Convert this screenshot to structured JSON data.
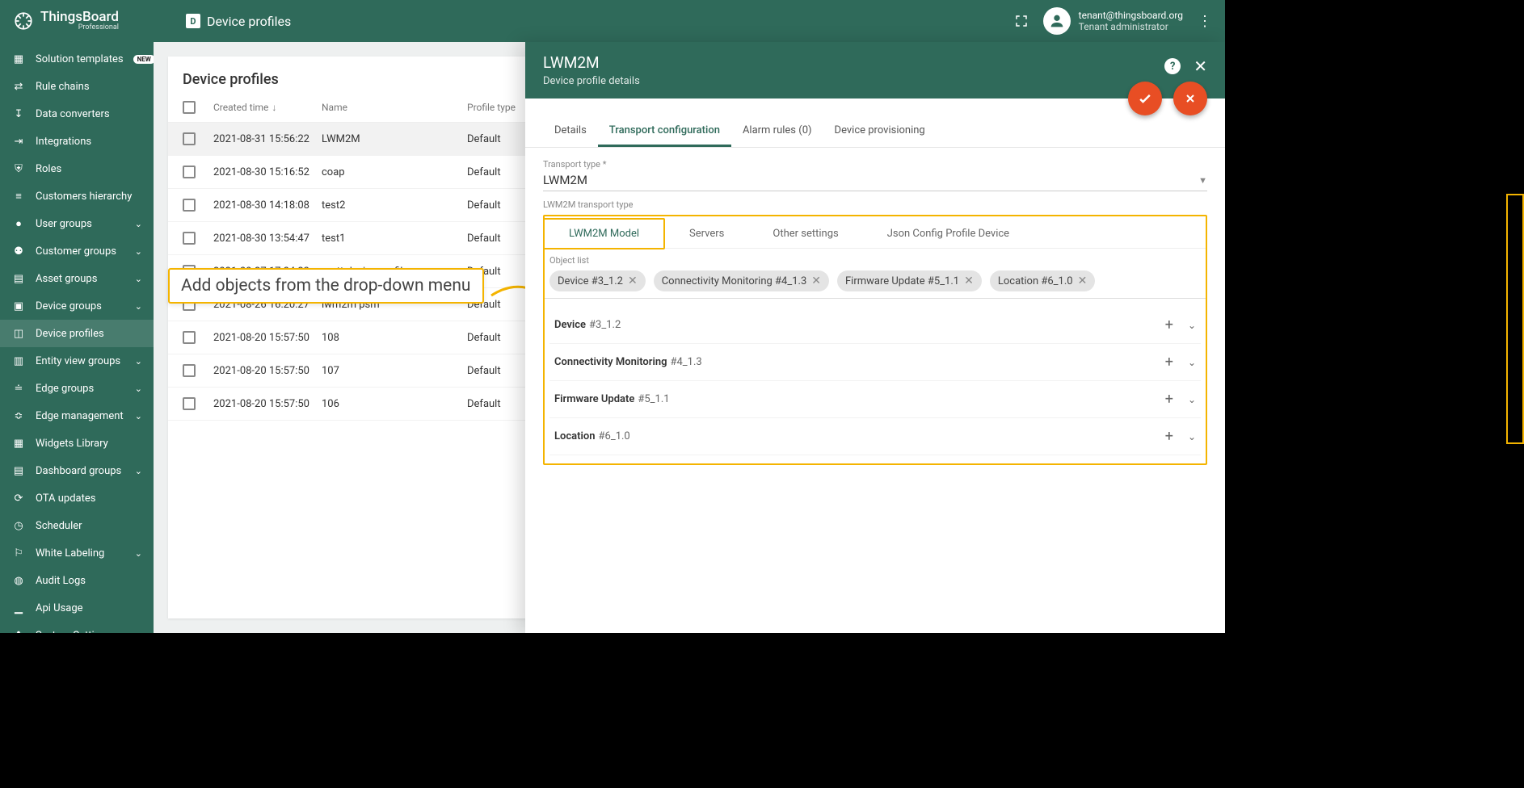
{
  "brand": {
    "name": "ThingsBoard",
    "edition": "Professional"
  },
  "topbar": {
    "title": "Device profiles"
  },
  "user": {
    "email": "tenant@thingsboard.org",
    "role": "Tenant administrator"
  },
  "sidebar": {
    "items": [
      {
        "label": "Solution templates",
        "badge": "NEW"
      },
      {
        "label": "Rule chains"
      },
      {
        "label": "Data converters"
      },
      {
        "label": "Integrations"
      },
      {
        "label": "Roles"
      },
      {
        "label": "Customers hierarchy"
      },
      {
        "label": "User groups",
        "chev": true
      },
      {
        "label": "Customer groups",
        "chev": true
      },
      {
        "label": "Asset groups",
        "chev": true
      },
      {
        "label": "Device groups",
        "chev": true
      },
      {
        "label": "Device profiles",
        "active": true
      },
      {
        "label": "Entity view groups",
        "chev": true
      },
      {
        "label": "Edge groups",
        "chev": true
      },
      {
        "label": "Edge management",
        "chev": true
      },
      {
        "label": "Widgets Library"
      },
      {
        "label": "Dashboard groups",
        "chev": true
      },
      {
        "label": "OTA updates"
      },
      {
        "label": "Scheduler"
      },
      {
        "label": "White Labeling",
        "chev": true
      },
      {
        "label": "Audit Logs"
      },
      {
        "label": "Api Usage"
      },
      {
        "label": "System Settings",
        "chev": true
      }
    ]
  },
  "table": {
    "title": "Device profiles",
    "headers": {
      "time": "Created time",
      "name": "Name",
      "type": "Profile type"
    },
    "rows": [
      {
        "time": "2021-08-31 15:56:22",
        "name": "LWM2M",
        "type": "Default",
        "selected": true
      },
      {
        "time": "2021-08-30 15:16:52",
        "name": "coap",
        "type": "Default"
      },
      {
        "time": "2021-08-30 14:18:08",
        "name": "test2",
        "type": "Default"
      },
      {
        "time": "2021-08-30 13:54:47",
        "name": "test1",
        "type": "Default"
      },
      {
        "time": "2021-08-27 17:04:23",
        "name": "mqtt device profile",
        "type": "Default"
      },
      {
        "time": "2021-08-26 16:20:27",
        "name": "lwm2m psm",
        "type": "Default"
      },
      {
        "time": "2021-08-20 15:57:50",
        "name": "108",
        "type": "Default"
      },
      {
        "time": "2021-08-20 15:57:50",
        "name": "107",
        "type": "Default"
      },
      {
        "time": "2021-08-20 15:57:50",
        "name": "106",
        "type": "Default"
      }
    ]
  },
  "drawer": {
    "title": "LWM2M",
    "subtitle": "Device profile details",
    "tabs": [
      "Details",
      "Transport configuration",
      "Alarm rules (0)",
      "Device provisioning"
    ],
    "active_tab": 1,
    "transport_type_label": "Transport type *",
    "transport_type_value": "LWM2M",
    "section_label": "LWM2M transport type",
    "subtabs": [
      "LWM2M Model",
      "Servers",
      "Other settings",
      "Json Config Profile Device"
    ],
    "object_list_label": "Object list",
    "chips": [
      "Device #3_1.2",
      "Connectivity Monitoring #4_1.3",
      "Firmware Update #5_1.1",
      "Location #6_1.0"
    ],
    "objects": [
      {
        "bold": "Device",
        "rest": "#3_1.2"
      },
      {
        "bold": "Connectivity Monitoring",
        "rest": "#4_1.3"
      },
      {
        "bold": "Firmware Update",
        "rest": "#5_1.1"
      },
      {
        "bold": "Location",
        "rest": "#6_1.0"
      }
    ]
  },
  "callout": "Add objects from the drop-down menu"
}
